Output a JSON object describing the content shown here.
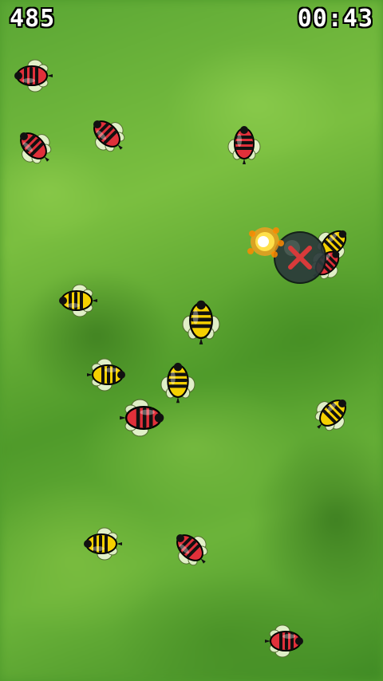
{
  "hud": {
    "score": "485",
    "timer": "00:43"
  },
  "colors": {
    "red_bug_body": "#e0303a",
    "yellow_bee_body": "#f5d000",
    "stripe": "#111111",
    "wing": "#e8f4d0",
    "bomb": "#2b3a3a",
    "bomb_mark": "#d83a3a",
    "spark": "#ffe04a"
  },
  "bugs": [
    {
      "kind": "red",
      "dir": "left"
    },
    {
      "kind": "red",
      "dir": "up-left"
    },
    {
      "kind": "red",
      "dir": "up-left"
    },
    {
      "kind": "red",
      "dir": "up"
    },
    {
      "kind": "yellow",
      "dir": "up-right"
    },
    {
      "kind": "yellow",
      "dir": "left"
    },
    {
      "kind": "yellow",
      "dir": "up"
    },
    {
      "kind": "yellow",
      "dir": "right"
    },
    {
      "kind": "yellow",
      "dir": "up"
    },
    {
      "kind": "red",
      "dir": "right"
    },
    {
      "kind": "yellow",
      "dir": "up-right"
    },
    {
      "kind": "yellow",
      "dir": "left"
    },
    {
      "kind": "red",
      "dir": "up-left"
    },
    {
      "kind": "red",
      "dir": "right"
    },
    {
      "kind": "red",
      "dir": "up-right"
    }
  ],
  "bomb": {
    "icon": "bomb-icon",
    "mark": "x-mark"
  }
}
